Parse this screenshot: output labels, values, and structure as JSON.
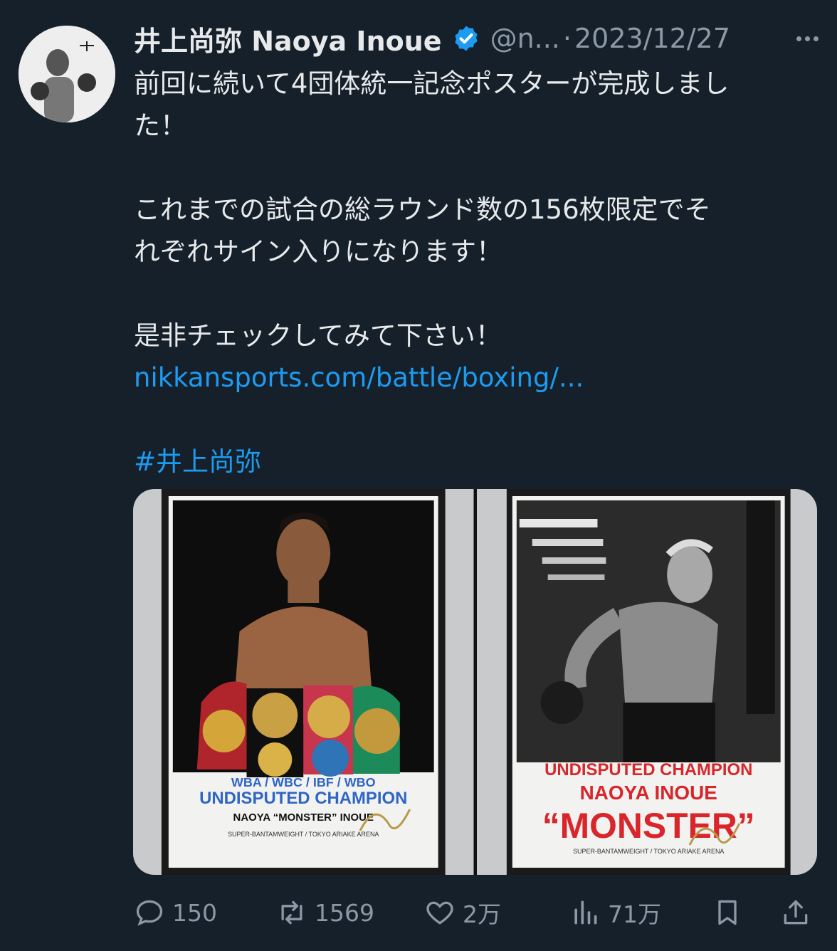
{
  "tweet": {
    "display_name": "井上尚弥  Naoya Inoue",
    "handle": "@n...",
    "separator": "·",
    "date": "2023/12/27",
    "text_lines": [
      "前回に続いて4団体統一記念ポスターが完成しまし",
      "た！",
      "",
      "これまでの試合の総ラウンド数の156枚限定でそ",
      "れぞれサイン入りになります！",
      "",
      "是非チェックしてみて下さい！"
    ],
    "link": "nikkansports.com/battle/boxing/...",
    "hashtag": "#井上尚弥"
  },
  "media": {
    "poster1": {
      "belt_line": "WBA / WBC / IBF / WBO",
      "headline": "UNDISPUTED CHAMPION",
      "name": "NAOYA “MONSTER” INOUE",
      "venue": "SUPER-BANTAMWEIGHT / TOKYO ARIAKE ARENA"
    },
    "poster2": {
      "headline": "UNDISPUTED CHAMPION",
      "name": "NAOYA INOUE",
      "nickname": "“MONSTER”",
      "venue": "SUPER-BANTAMWEIGHT / TOKYO ARIAKE ARENA"
    }
  },
  "actions": {
    "replies": "150",
    "retweets": "1569",
    "likes": "2万",
    "views": "71万"
  },
  "colors": {
    "background": "#15202b",
    "text": "#e7e9ea",
    "muted": "#8b98a5",
    "link": "#1d9bf0",
    "verified": "#1d9bf0"
  },
  "icons": {
    "verified": "verified-badge-icon",
    "more": "more-icon",
    "reply": "reply-icon",
    "retweet": "retweet-icon",
    "like": "heart-icon",
    "views": "views-chart-icon",
    "bookmark": "bookmark-icon",
    "share": "share-icon"
  }
}
